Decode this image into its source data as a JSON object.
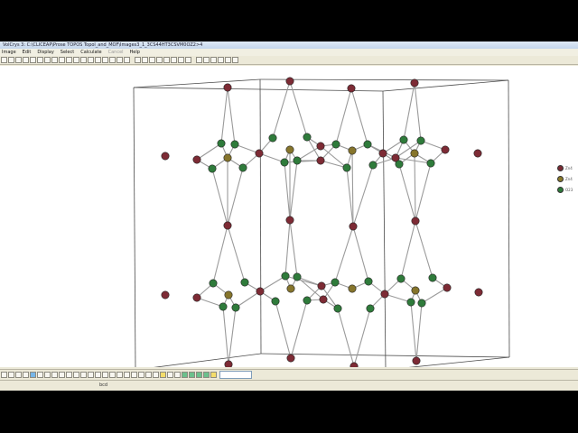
{
  "window": {
    "title": "VolCrys 3: C:\\CLICEAP\\Prose TOPOS Topol_and_MOF\\Images3_1_3CS44HT3CSVM0OZ2>4",
    "menu": [
      "Image",
      "Edit",
      "Display",
      "Select",
      "Calculate",
      "Cancel",
      "Help"
    ],
    "menu_disabled": [
      false,
      false,
      false,
      false,
      false,
      true,
      false
    ]
  },
  "legend": [
    {
      "label": "Zn4",
      "color": "#7a2a33"
    },
    {
      "label": "Zn4",
      "color": "#8a7a2a"
    },
    {
      "label": "O23",
      "color": "#2e7a3a"
    }
  ],
  "status": {
    "text": "bcd"
  },
  "colors": {
    "red_atom": "#7d2b35",
    "yellow_atom": "#86752c",
    "green_atom": "#2f7b3b",
    "bond": "#9a9a9a",
    "cell": "#4a4a4a"
  }
}
